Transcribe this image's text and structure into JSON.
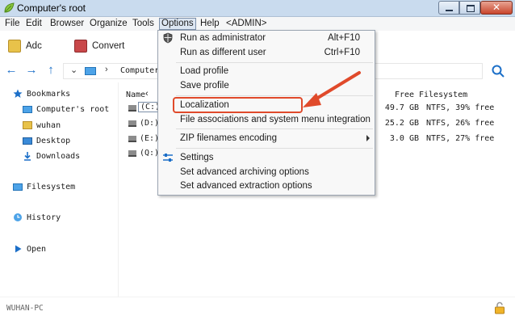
{
  "window": {
    "title": "Computer's root"
  },
  "menubar": {
    "items": [
      "File",
      "Edit",
      "Browser",
      "Organize",
      "Tools",
      "Options",
      "Help",
      "<ADMIN>"
    ]
  },
  "toolbar": {
    "add_label": "Adc",
    "convert_label": "Convert"
  },
  "address": {
    "path": "Computer's"
  },
  "sidebar": {
    "bookmarks": "Bookmarks",
    "computer_root": "Computer's root",
    "wuhan": "wuhan",
    "desktop": "Desktop",
    "downloads": "Downloads",
    "filesystem": "Filesystem",
    "history": "History",
    "open": "Open"
  },
  "filepane": {
    "col_name": "Name",
    "col_free": "Free",
    "col_filesystem": "Filesystem",
    "drives": [
      {
        "name": "(C:)",
        "free": "49.7 GB",
        "fs": "NTFS, 39% free"
      },
      {
        "name": "(D:)",
        "free": "25.2 GB",
        "fs": "NTFS, 26% free"
      },
      {
        "name": "(E:)",
        "free": "3.0 GB",
        "fs": "NTFS, 27% free"
      },
      {
        "name": "(Q:)",
        "free": "",
        "fs": ""
      }
    ]
  },
  "dropdown": {
    "run_admin": "Run as administrator",
    "run_admin_shortcut": "Alt+F10",
    "run_different": "Run as different user",
    "run_different_shortcut": "Ctrl+F10",
    "load_profile": "Load profile",
    "save_profile": "Save profile",
    "localization": "Localization",
    "file_assoc": "File associations and system menu integration",
    "zip_encoding": "ZIP filenames encoding",
    "settings": "Settings",
    "adv_archiving": "Set advanced archiving options",
    "adv_extraction": "Set advanced extraction options"
  },
  "status": {
    "computer_name": "WUHAN-PC"
  },
  "colors": {
    "accent": "#1c6fc8",
    "annotation": "#e04a2b",
    "titlebar": "#c9dbee"
  }
}
